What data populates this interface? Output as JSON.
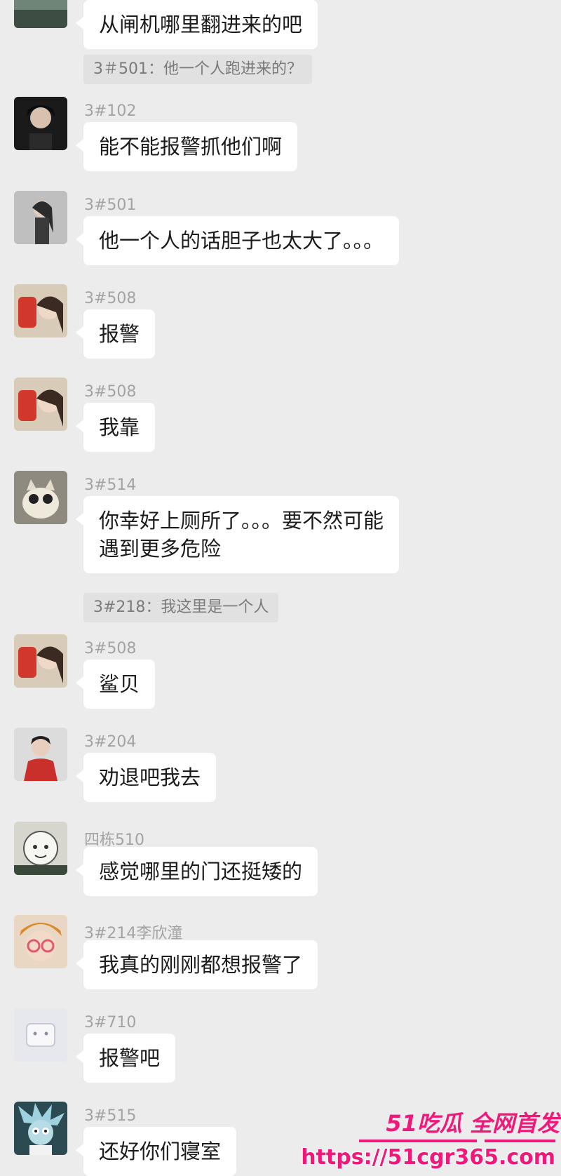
{
  "chat": {
    "first_bubble": "从闸机哪里翻进来的吧",
    "quote1": "3＃501：他一个人跑进来的？",
    "quote2": "3#218：我这里是一个人",
    "messages": [
      {
        "sender": "3#102",
        "text": "能不能报警抓他们啊"
      },
      {
        "sender": "3#501",
        "text": "他一个人的话胆子也太大了。。。"
      },
      {
        "sender": "3#508",
        "text": "报警"
      },
      {
        "sender": "3#508",
        "text": "我靠"
      },
      {
        "sender": "3#514",
        "text_line1": "你幸好上厕所了。。。要不然可能",
        "text_line2": "遇到更多危险"
      },
      {
        "sender": "3#508",
        "text": "鲨贝"
      },
      {
        "sender": "3#204",
        "text": "劝退吧我去"
      },
      {
        "sender": "四栋510",
        "text": "感觉哪里的门还挺矮的"
      },
      {
        "sender": "3#214李欣潼",
        "text": "我真的刚刚都想报警了"
      },
      {
        "sender": "3#710",
        "text": "报警吧"
      },
      {
        "sender": "3#515",
        "text": "还好你们寝室"
      }
    ]
  },
  "watermark": {
    "brand": "51吃瓜 全网首发",
    "url": "https://51cgr365.com"
  },
  "colors": {
    "background": "#ececec",
    "bubble": "#ffffff",
    "quote_bg": "#e1e1e1",
    "sender_text": "#a3a3a3",
    "watermark": "#f0197a"
  }
}
